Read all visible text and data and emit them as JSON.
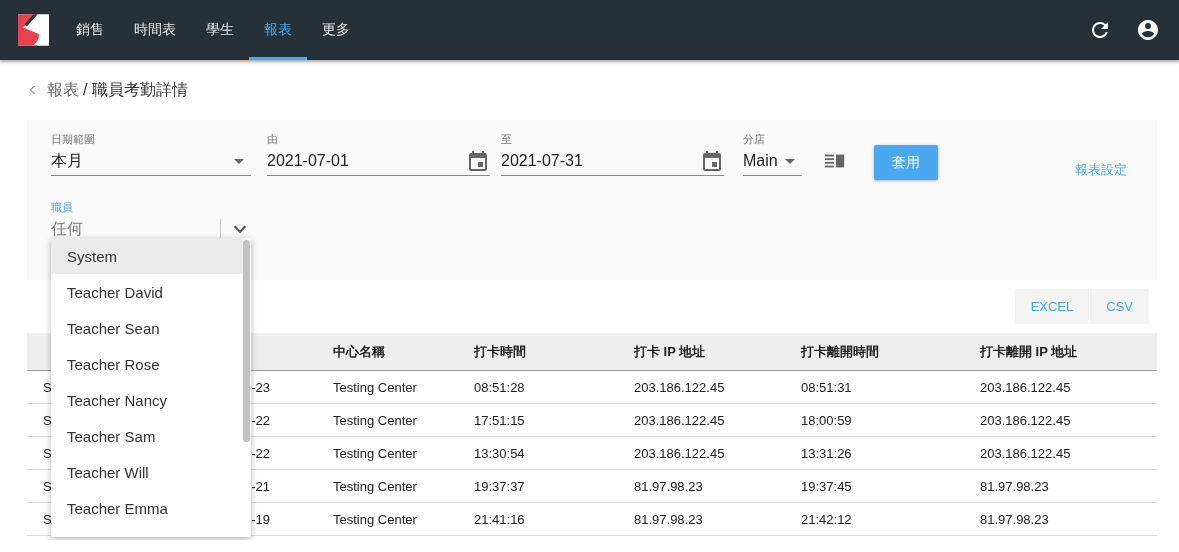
{
  "nav": {
    "tabs": [
      {
        "label": "銷售",
        "selected": false
      },
      {
        "label": "時間表",
        "selected": false
      },
      {
        "label": "學生",
        "selected": false
      },
      {
        "label": "報表",
        "selected": true
      },
      {
        "label": "更多",
        "selected": false
      }
    ]
  },
  "breadcrumb": {
    "parent": "報表",
    "current": "/ 職員考勤詳情"
  },
  "filters": {
    "date_range": {
      "label": "日期範圍",
      "value": "本月"
    },
    "from": {
      "label": "由",
      "value": "2021-07-01"
    },
    "to": {
      "label": "至",
      "value": "2021-07-31"
    },
    "branch": {
      "label": "分店",
      "value": "Main"
    },
    "apply_button": "套用",
    "settings_link": "報表設定",
    "staff": {
      "label": "職員",
      "placeholder": "任何",
      "focused": true
    }
  },
  "staff_options": [
    {
      "label": "System",
      "selected": true
    },
    {
      "label": "Teacher David",
      "selected": false
    },
    {
      "label": "Teacher Sean",
      "selected": false
    },
    {
      "label": "Teacher Rose",
      "selected": false
    },
    {
      "label": "Teacher Nancy",
      "selected": false
    },
    {
      "label": "Teacher Sam",
      "selected": false
    },
    {
      "label": "Teacher Will",
      "selected": false
    },
    {
      "label": "Teacher Emma",
      "selected": false
    }
  ],
  "export_buttons": [
    "EXCEL",
    "CSV"
  ],
  "table": {
    "columns": {
      "center_name": "中心名稱",
      "clock_in_time": "打卡時間",
      "clock_in_ip": "打卡 IP 地址",
      "clock_out_time": "打卡離開時間",
      "clock_out_ip": "打卡離開 IP 地址"
    },
    "rows": [
      [
        "S",
        "-23",
        "Testing Center",
        "08:51:28",
        "203.186.122.45",
        "08:51:31",
        "203.186.122.45"
      ],
      [
        "S",
        "-22",
        "Testing Center",
        "17:51:15",
        "203.186.122.45",
        "18:00:59",
        "203.186.122.45"
      ],
      [
        "S",
        "-22",
        "Testing Center",
        "13:30:54",
        "203.186.122.45",
        "13:31:26",
        "203.186.122.45"
      ],
      [
        "S",
        "-21",
        "Testing Center",
        "19:37:37",
        "81.97.98.23",
        "19:37:45",
        "81.97.98.23"
      ],
      [
        "S",
        "-19",
        "Testing Center",
        "21:41:16",
        "81.97.98.23",
        "21:42:12",
        "81.97.98.23"
      ]
    ]
  }
}
